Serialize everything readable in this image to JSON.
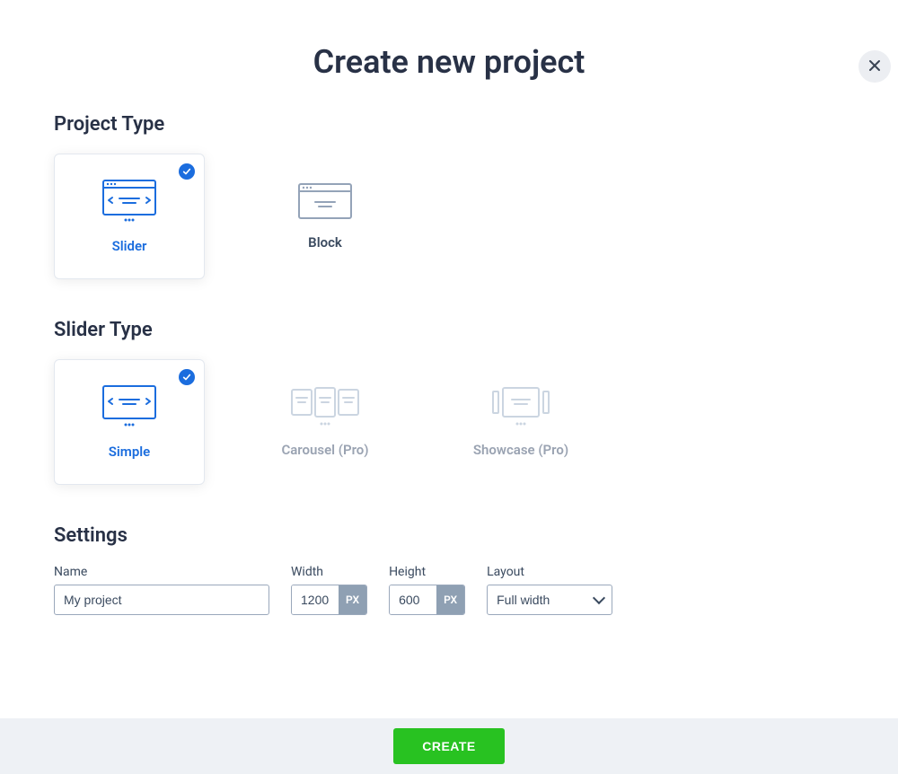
{
  "modal": {
    "title": "Create new project"
  },
  "sections": {
    "project_type": {
      "title": "Project Type",
      "options": [
        {
          "label": "Slider",
          "selected": true
        },
        {
          "label": "Block",
          "selected": false
        }
      ]
    },
    "slider_type": {
      "title": "Slider Type",
      "options": [
        {
          "label": "Simple",
          "selected": true,
          "disabled": false
        },
        {
          "label": "Carousel (Pro)",
          "selected": false,
          "disabled": true
        },
        {
          "label": "Showcase (Pro)",
          "selected": false,
          "disabled": true
        }
      ]
    },
    "settings": {
      "title": "Settings",
      "name": {
        "label": "Name",
        "value": "My project"
      },
      "width": {
        "label": "Width",
        "value": "1200",
        "unit": "PX"
      },
      "height": {
        "label": "Height",
        "value": "600",
        "unit": "PX"
      },
      "layout": {
        "label": "Layout",
        "selected": "Full width"
      }
    }
  },
  "footer": {
    "create_label": "CREATE"
  },
  "icons": {
    "close": "close-icon",
    "check": "check-icon"
  },
  "colors": {
    "accent_blue": "#1b6dde",
    "success_green": "#28c221",
    "muted": "#9aa3b2"
  }
}
